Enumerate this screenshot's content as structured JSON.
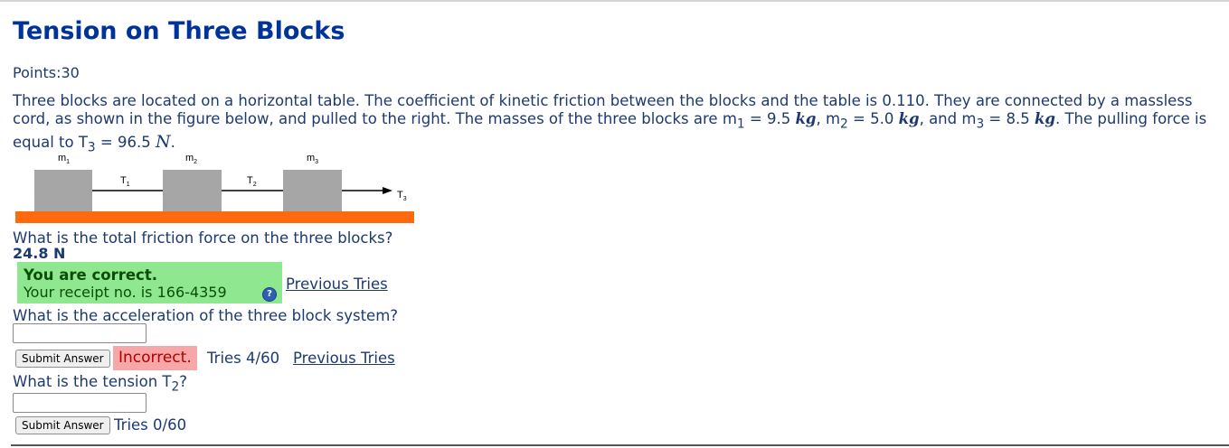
{
  "title": "Tension on Three Blocks",
  "points": "Points:30",
  "problem": {
    "part1": "Three blocks are located on a horizontal table. The coefficient of kinetic friction between the blocks and the table is 0.110. They are connected by a massless cord, as shown in the figure below, and pulled to the right. The masses of the three blocks are m",
    "sub1": "1",
    "part2": " = 9.5 ",
    "unit_kg": "kg",
    "part3": ", m",
    "sub2": "2",
    "part4": " = 5.0 ",
    "part5": ", and m",
    "sub3": "3",
    "part6": " = 8.5 ",
    "part7": ". The pulling force is equal to T",
    "sub4": "3",
    "part8": " = 96.5 ",
    "unit_N": "N",
    "part9": "."
  },
  "figure": {
    "mass_labels": [
      "m",
      "m",
      "m"
    ],
    "mass_subs": [
      "1",
      "2",
      "3"
    ],
    "tension_labels": [
      "T",
      "T",
      "T"
    ],
    "tension_subs": [
      "1",
      "2",
      "3"
    ],
    "block_color": "#a6a6a6",
    "table_color": "#ff6a0f"
  },
  "q1": {
    "question": "What is the total friction force on the three blocks?",
    "answer": "24.8 N",
    "status": "You are correct.",
    "receipt": "Your receipt no. is 166-4359",
    "help_icon": "question-mark-icon",
    "previous_tries": "Previous Tries"
  },
  "q2": {
    "question": "What is the acceleration of the three block system?",
    "input_value": "",
    "submit_label": "Submit Answer",
    "status": "Incorrect.",
    "tries": "Tries 4/60",
    "previous_tries": "Previous Tries"
  },
  "q3": {
    "question_prefix": "What is the tension T",
    "question_sub": "2",
    "question_suffix": "?",
    "input_value": "",
    "submit_label": "Submit Answer",
    "tries": "Tries 0/60"
  },
  "colors": {
    "title": "#003399",
    "text": "#1d3a70",
    "correct_bg": "#8fe88f",
    "incorrect_bg": "#f7a7a7"
  }
}
